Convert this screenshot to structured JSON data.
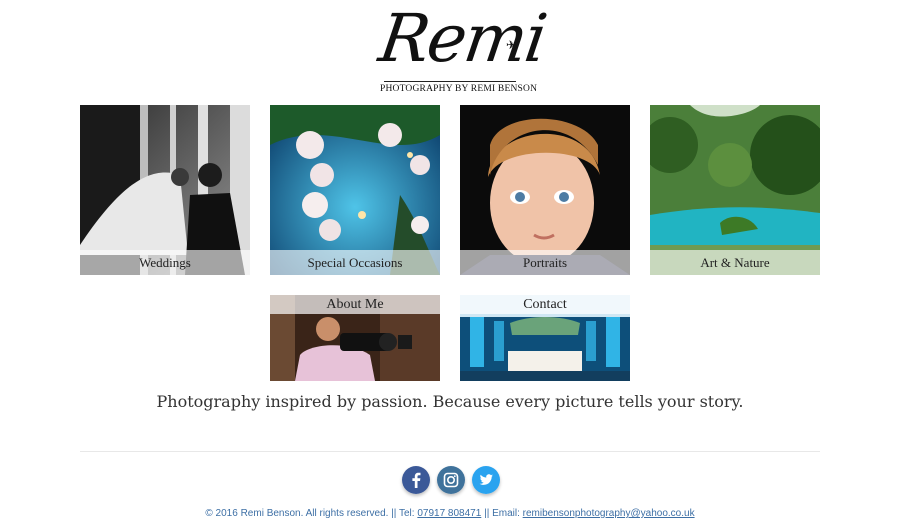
{
  "brand": {
    "logo_word": "Remi",
    "logo_subtitle": "PHOTOGRAPHY BY REMI BENSON"
  },
  "gallery": [
    {
      "label": "Weddings",
      "image": "bride-and-groom-photo"
    },
    {
      "label": "Special Occasions",
      "image": "floral-event-decor-photo"
    },
    {
      "label": "Portraits",
      "image": "child-portrait-photo"
    },
    {
      "label": "Art & Nature",
      "image": "river-landscape-photo"
    }
  ],
  "pages": [
    {
      "label": "About Me",
      "image": "photographer-with-camera-photo"
    },
    {
      "label": "Contact",
      "image": "banquet-hall-photo"
    }
  ],
  "tagline": "Photography inspired by passion. Because every picture tells your story.",
  "social": [
    {
      "icon": "facebook-icon",
      "color": "#3b5998"
    },
    {
      "icon": "instagram-icon",
      "color": "#3f729b"
    },
    {
      "icon": "twitter-icon",
      "color": "#2aa3ef"
    }
  ],
  "footer": {
    "copyright": "© 2016 Remi Benson. All rights reserved. || Tel: ",
    "phone": "07917 808471",
    "email_prefix": " || Email: ",
    "email": "remibensonphotography@yahoo.co.uk"
  }
}
